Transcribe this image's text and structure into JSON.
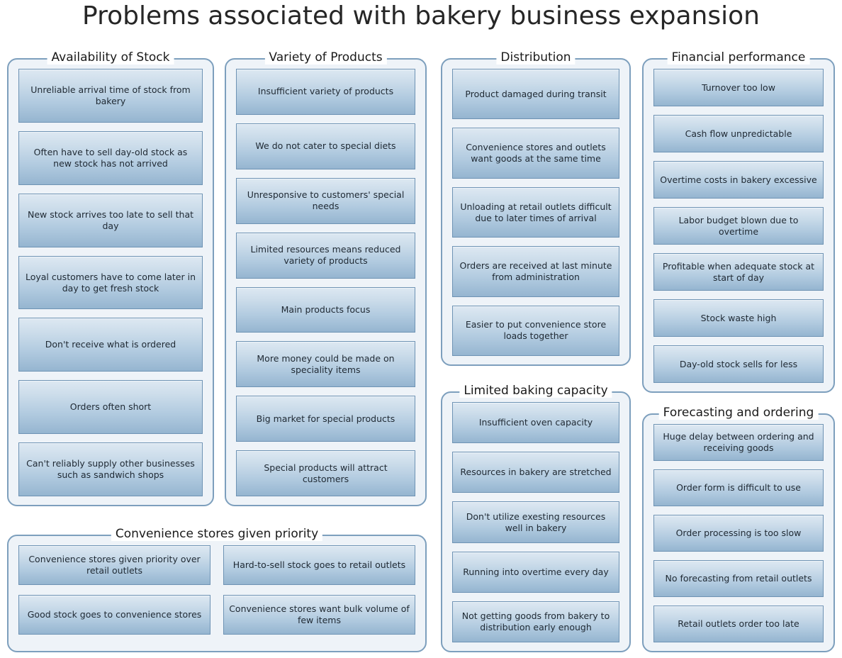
{
  "title": "Problems associated with bakery business expansion",
  "theme": {
    "page_background": "#ffffff",
    "title_color": "#262626",
    "group_border": "#7d9fbd",
    "group_fill": "#eef3f8",
    "node_border": "#6e93b4",
    "node_gradient_top": "#dde8f2",
    "node_gradient_bottom": "#95b5d0",
    "node_text": "#1f2933"
  },
  "groups": [
    {
      "id": "availability",
      "title": "Availability of Stock",
      "items": [
        "Unreliable arrival time of stock from bakery",
        "Often have to sell day-old stock as new stock has not arrived",
        "New stock arrives too late to sell that day",
        "Loyal customers have to come later in day to get fresh stock",
        "Don't receive what is ordered",
        "Orders often short",
        "Can't reliably supply other businesses such as sandwich shops"
      ]
    },
    {
      "id": "variety",
      "title": "Variety of Products",
      "items": [
        "Insufficient variety of products",
        "We do not cater to special diets",
        "Unresponsive to customers' special needs",
        "Limited resources means reduced variety of products",
        "Main products focus",
        "More money could be made on speciality items",
        "Big market for special products",
        "Special products will attract customers"
      ]
    },
    {
      "id": "distribution",
      "title": "Distribution",
      "items": [
        "Product damaged during transit",
        "Convenience stores and outlets want goods at the same time",
        "Unloading at retail outlets difficult due to later times of arrival",
        "Orders are received at last minute from administration",
        "Easier to put convenience store loads together"
      ]
    },
    {
      "id": "financial",
      "title": "Financial performance",
      "items": [
        "Turnover too low",
        "Cash flow unpredictable",
        "Overtime costs in bakery excessive",
        "Labor budget blown due to overtime",
        "Profitable when adequate stock at start of day",
        "Stock waste high",
        "Day-old stock sells for less"
      ]
    },
    {
      "id": "baking",
      "title": "Limited baking capacity",
      "items": [
        "Insufficient oven capacity",
        "Resources in bakery are stretched",
        "Don't utilize exesting resources well in bakery",
        "Running into overtime every day",
        "Not getting goods from bakery to distribution early enough"
      ]
    },
    {
      "id": "forecasting",
      "title": "Forecasting and ordering",
      "items": [
        "Huge delay between ordering and receiving goods",
        "Order form is difficult to use",
        "Order processing is too slow",
        "No forecasting from retail outlets",
        "Retail outlets order too late"
      ]
    },
    {
      "id": "convenience",
      "title": "Convenience stores given priority",
      "items": [
        "Convenience stores given priority over retail outlets",
        "Hard-to-sell stock goes to retail outlets",
        "Good stock goes to convenience stores",
        "Convenience stores want bulk volume of few items"
      ]
    }
  ]
}
